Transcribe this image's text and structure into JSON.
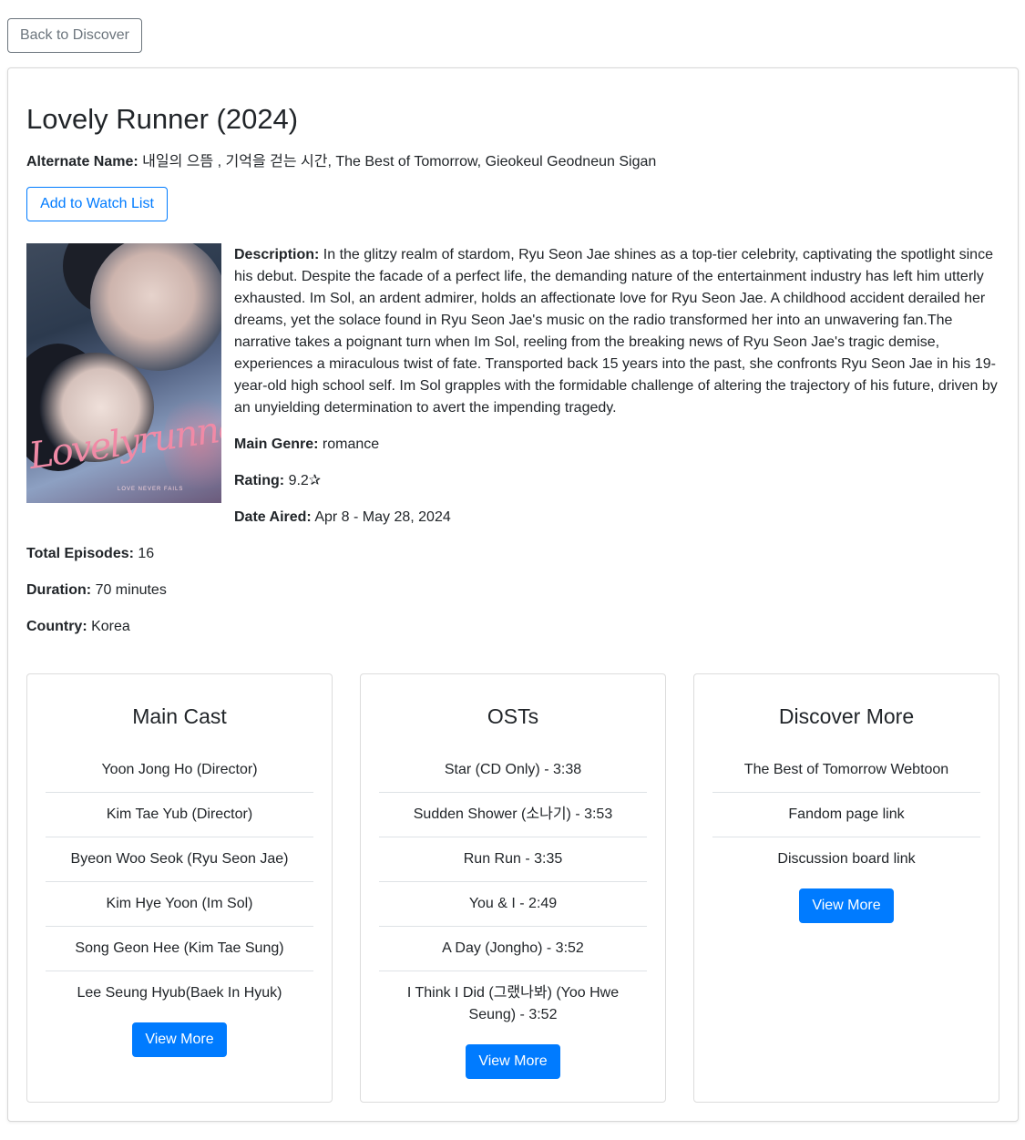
{
  "nav": {
    "back_label": "Back to Discover"
  },
  "show": {
    "title": "Lovely Runner (2024)",
    "alternate_name_label": "Alternate Name:",
    "alternate_name": "내일의 으뜸 , 기억을 걷는 시간, The Best of Tomorrow, Gieokeul Geodneun Sigan",
    "watch_list_label": "Add to Watch List",
    "poster_script": "Lovelyrunner",
    "poster_tagline": "LOVE NEVER FAILS",
    "description_label": "Description:",
    "description": "In the glitzy realm of stardom, Ryu Seon Jae shines as a top-tier celebrity, captivating the spotlight since his debut. Despite the facade of a perfect life, the demanding nature of the entertainment industry has left him utterly exhausted. Im Sol, an ardent admirer, holds an affectionate love for Ryu Seon Jae. A childhood accident derailed her dreams, yet the solace found in Ryu Seon Jae's music on the radio transformed her into an unwavering fan.The narrative takes a poignant turn when Im Sol, reeling from the breaking news of Ryu Seon Jae's tragic demise, experiences a miraculous twist of fate. Transported back 15 years into the past, she confronts Ryu Seon Jae in his 19-year-old high school self. Im Sol grapples with the formidable challenge of altering the trajectory of his future, driven by an unyielding determination to avert the impending tragedy.",
    "genre_label": "Main Genre:",
    "genre": "romance",
    "rating_label": "Rating:",
    "rating": "9.2✰",
    "date_label": "Date Aired:",
    "date": "Apr 8 - May 28, 2024",
    "episodes_label": "Total Episodes:",
    "episodes": "16",
    "duration_label": "Duration:",
    "duration": "70 minutes",
    "country_label": "Country:",
    "country": "Korea"
  },
  "cast": {
    "title": "Main Cast",
    "items": [
      "Yoon Jong Ho (Director)",
      "Kim Tae Yub (Director)",
      "Byeon Woo Seok (Ryu Seon Jae)",
      "Kim Hye Yoon (Im Sol)",
      "Song Geon Hee (Kim Tae Sung)",
      "Lee Seung Hyub(Baek In Hyuk)"
    ],
    "button": "View More"
  },
  "osts": {
    "title": "OSTs",
    "items": [
      "Star (CD Only) - 3:38",
      "Sudden Shower (소나기) - 3:53",
      "Run Run - 3:35",
      "You & I - 2:49",
      "A Day (Jongho) - 3:52",
      "I Think I Did (그랬나봐) (Yoo Hwe Seung) - 3:52"
    ],
    "button": "View More"
  },
  "discover": {
    "title": "Discover More",
    "items": [
      "The Best of Tomorrow Webtoon",
      "Fandom page link",
      "Discussion board link"
    ],
    "button": "View More"
  },
  "colors": {
    "primary": "#007bff",
    "secondary": "#6c757d",
    "text": "#212529",
    "border": "#dee2e6"
  }
}
